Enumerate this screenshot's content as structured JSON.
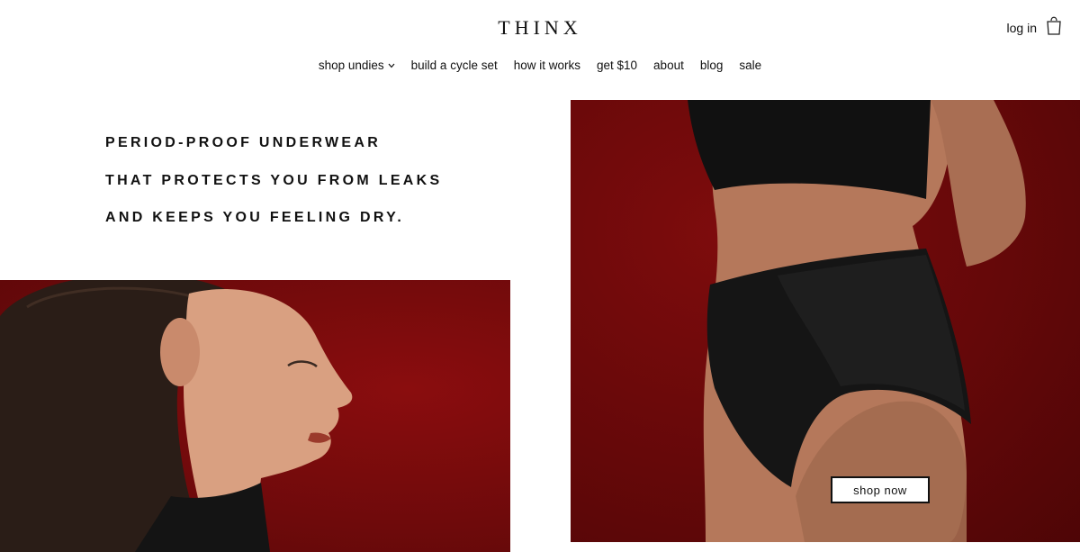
{
  "header": {
    "logo": "THINX",
    "login_label": "log in",
    "bag_icon": "shopping-bag-icon"
  },
  "nav": {
    "items": [
      {
        "label": "shop undies",
        "has_dropdown": true
      },
      {
        "label": "build a cycle set"
      },
      {
        "label": "how it works"
      },
      {
        "label": "get $10"
      },
      {
        "label": "about"
      },
      {
        "label": "blog"
      },
      {
        "label": "sale"
      }
    ]
  },
  "hero": {
    "lines": [
      "PERIOD-PROOF UNDERWEAR",
      "THAT PROTECTS YOU FROM LEAKS",
      "AND KEEPS YOU FEELING DRY."
    ]
  },
  "cta": {
    "shop_now_label": "shop now"
  },
  "colors": {
    "brand_red": "#6e0a0b",
    "text": "#111111",
    "background": "#ffffff"
  }
}
